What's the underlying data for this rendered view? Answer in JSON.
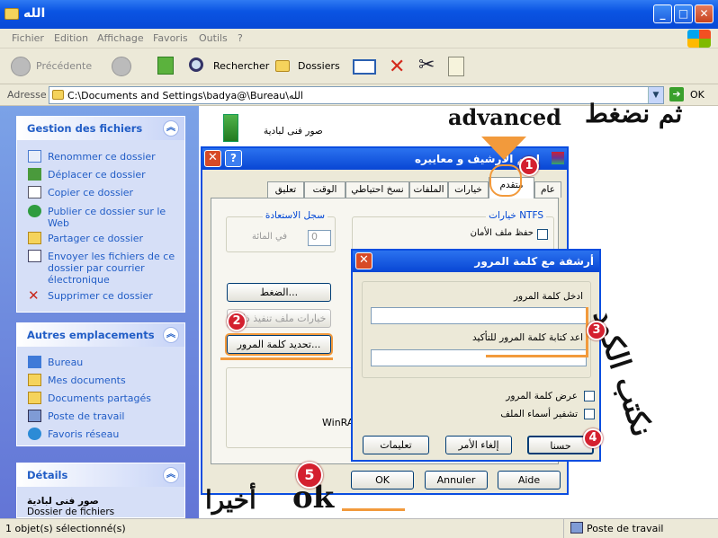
{
  "window": {
    "title": "الله"
  },
  "menu": [
    "Fichier",
    "Edition",
    "Affichage",
    "Favoris",
    "Outils",
    "?"
  ],
  "toolbar": {
    "back": "Précédente",
    "search": "Rechercher",
    "folders": "Dossiers"
  },
  "address": {
    "label": "Adresse",
    "path": "C:\\Documents and Settings\\badya@\\Bureau\\الله",
    "go": "OK"
  },
  "file_tasks": {
    "title": "Gestion des fichiers",
    "items": [
      "Renommer ce dossier",
      "Déplacer ce dossier",
      "Copier ce dossier",
      "Publier ce dossier sur le Web",
      "Partager ce dossier",
      "Envoyer les fichiers de ce dossier par courrier électronique",
      "Supprimer ce dossier"
    ]
  },
  "other_places": {
    "title": "Autres emplacements",
    "items": [
      "Bureau",
      "Mes documents",
      "Documents partagés",
      "Poste de travail",
      "Favoris réseau"
    ]
  },
  "details": {
    "title": "Détails",
    "name": "صور فنى لبادية",
    "type": "Dossier de fichiers"
  },
  "file": {
    "name": "صور فنى لبادية"
  },
  "archive_dialog": {
    "title": "اسم الأرشيف و معاييره",
    "tabs": [
      "عام",
      "متقدم",
      "خيارات",
      "الملفات",
      "نسخ احتياطي",
      "الوقت",
      "تعليق"
    ],
    "ntfs_group": "خيارات NTFS",
    "ntfs_option": "حفظ ملف الأمان",
    "recovery_group": "سجل الاستعادة",
    "recovery_value": "0",
    "recovery_unit": "في المائة",
    "compress_btn": "الضغط...",
    "sfx_btn": "خيارات ملف تنفيذ ذاتي",
    "password_btn": "تحديد كلمة المرور...",
    "winrar": "WinRA",
    "ok": "OK",
    "cancel": "Annuler",
    "help": "Aide"
  },
  "password_dialog": {
    "title": "أرشفة مع كلمة المرور",
    "enter_label": "ادخل كلمة المرور",
    "confirm_label": "اعد كتابة كلمة المرور للتأكيد",
    "show_pw": "عرض كلمة المرور",
    "encrypt_names": "تشفير أسماء الملف",
    "ok": "حسنا",
    "cancel": "إلغاء الأمر",
    "help": "تعليمات"
  },
  "annotations": {
    "then_press": "ثم نضغط",
    "advanced": "advanced",
    "write_code": "نكتب الكود",
    "finally": "أخيرا",
    "ok": "ok",
    "n1": "1",
    "n2": "2",
    "n3": "3",
    "n4": "4",
    "n5": "5"
  },
  "status": {
    "left": "1 objet(s) sélectionné(s)",
    "right": "Poste de travail"
  },
  "colors": {
    "xp_blue": "#0a54e3",
    "link": "#215dc6",
    "badge": "#d4202f",
    "highlight": "#f29a3c"
  }
}
